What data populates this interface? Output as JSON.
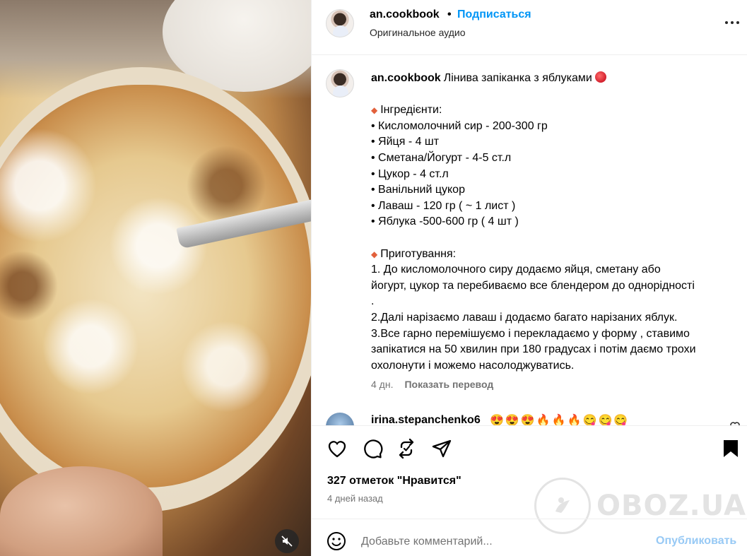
{
  "post": {
    "author": "an.cookbook",
    "separator": "•",
    "follow_label": "Подписаться",
    "audio": "Оригинальное аудио"
  },
  "caption": {
    "title": "Лінива запіканка з яблуками",
    "lines": [
      "",
      "Інгредієнти:",
      "• Кисломолочний сир - 200-300 гр",
      "• Яйця - 4 шт",
      "• Сметана/Йогурт - 4-5 ст.л",
      "• Цукор - 4 ст.л",
      "• Ванільний цукор",
      "• Лаваш - 120 гр ( ~ 1 лист )",
      "• Яблука -500-600 гр ( 4 шт )",
      "",
      "Приготування:",
      "1. До кисломолочного сиру додаємо яйця, сметану або",
      "йогурт, цукор та перебиваємо все блендером до однорідності",
      ".",
      "2.Далі нарізаємо лаваш і додаємо багато нарізаних яблук.",
      "3.Все гарно перемішуємо і перекладаємо у форму , ставимо",
      "запікатися на 50 хвилин при 180 градусах і потім даємо трохи",
      "охолонути і можемо насолоджуватись."
    ],
    "age": "4 дн.",
    "translate_label": "Показать перевод"
  },
  "comment": {
    "author": "irina.stepanchenko6",
    "text": "😍😍😍🔥🔥🔥😋😋😋"
  },
  "likes_label": "327 отметок \"Нравится\"",
  "time_ago": "4 дней назад",
  "add_comment": {
    "placeholder": "Добавьте комментарий...",
    "publish_label": "Опубликовать"
  },
  "watermark": "OBOZ.UA",
  "colors": {
    "link_blue": "#0095f6",
    "publish_disabled": "#97c9f5",
    "muted_text": "#737373",
    "divider": "#efefef"
  }
}
